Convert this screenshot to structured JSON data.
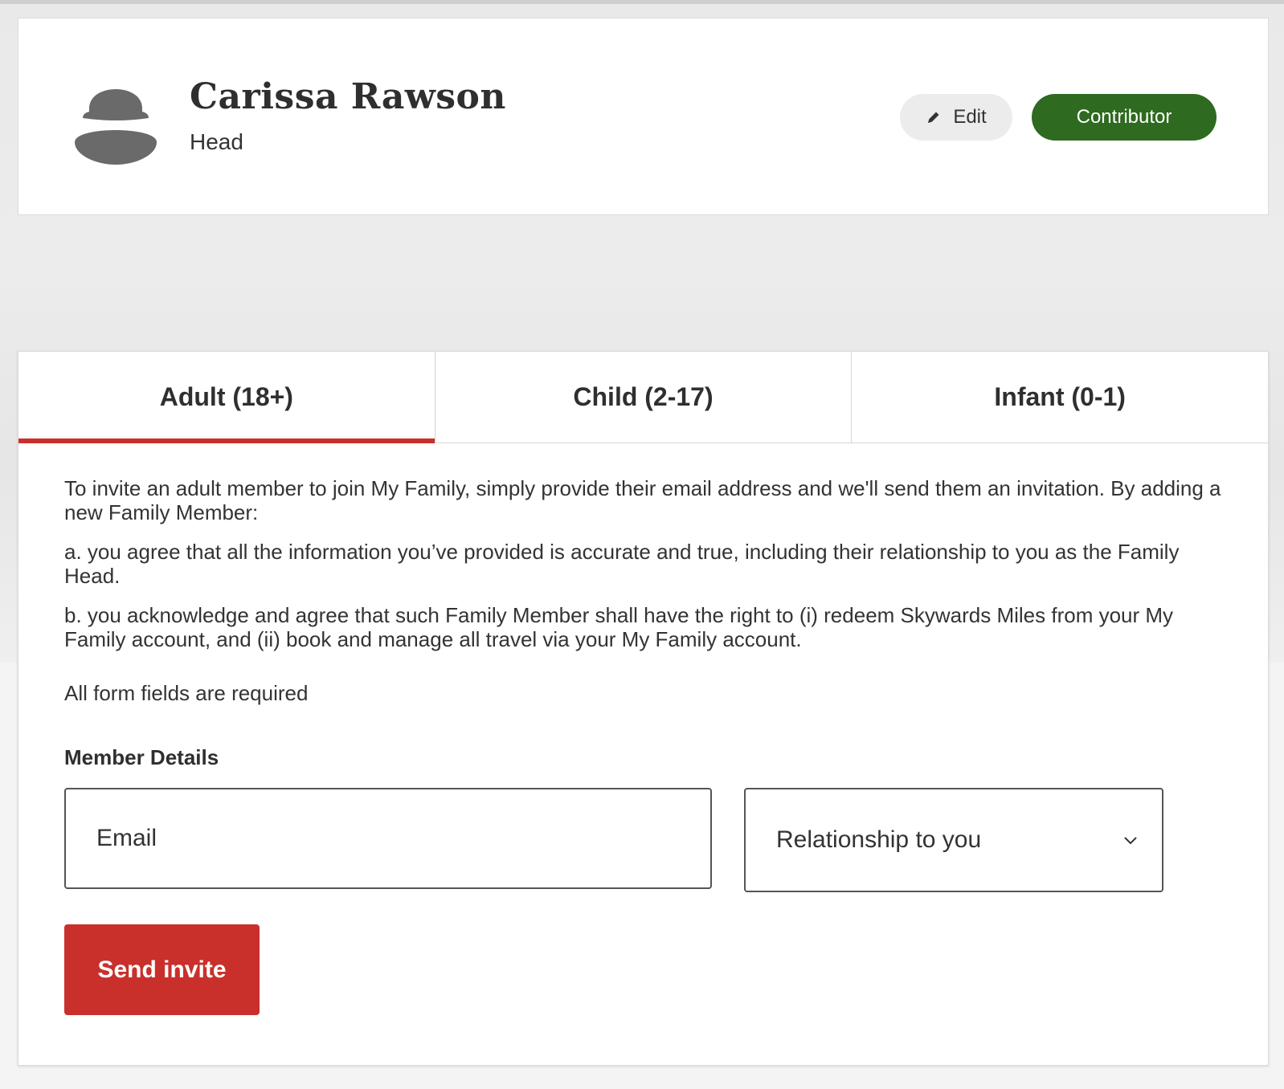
{
  "profile": {
    "name": "Carissa Rawson",
    "role": "Head",
    "edit_label": "Edit",
    "contributor_label": "Contributor"
  },
  "tabs": [
    {
      "label": "Adult (18+)",
      "active": true
    },
    {
      "label": "Child (2-17)",
      "active": false
    },
    {
      "label": "Infant (0-1)",
      "active": false
    }
  ],
  "intro": {
    "p1": "To invite an adult member to join My Family, simply provide their email address and we'll send them an invitation. By adding a new Family Member:",
    "p2": "a. you agree that all the information you’ve provided is accurate and true, including their relationship to you as the Family Head.",
    "p3": "b. you acknowledge and agree that such Family Member shall have the right to (i) redeem Skywards Miles from your My Family account, and (ii) book and manage all travel via your My Family account."
  },
  "form": {
    "required_note": "All form fields are required",
    "section_title": "Member Details",
    "email_placeholder": "Email",
    "email_value": "",
    "relationship_placeholder": "Relationship to you",
    "send_label": "Send invite"
  },
  "icons": {
    "avatar": "user-silhouette-icon",
    "edit": "pencil-icon",
    "dropdown": "chevron-down-icon"
  },
  "colors": {
    "accent_red": "#c9302c",
    "contributor_green": "#2e6a1f",
    "edit_bg": "#ececec"
  }
}
